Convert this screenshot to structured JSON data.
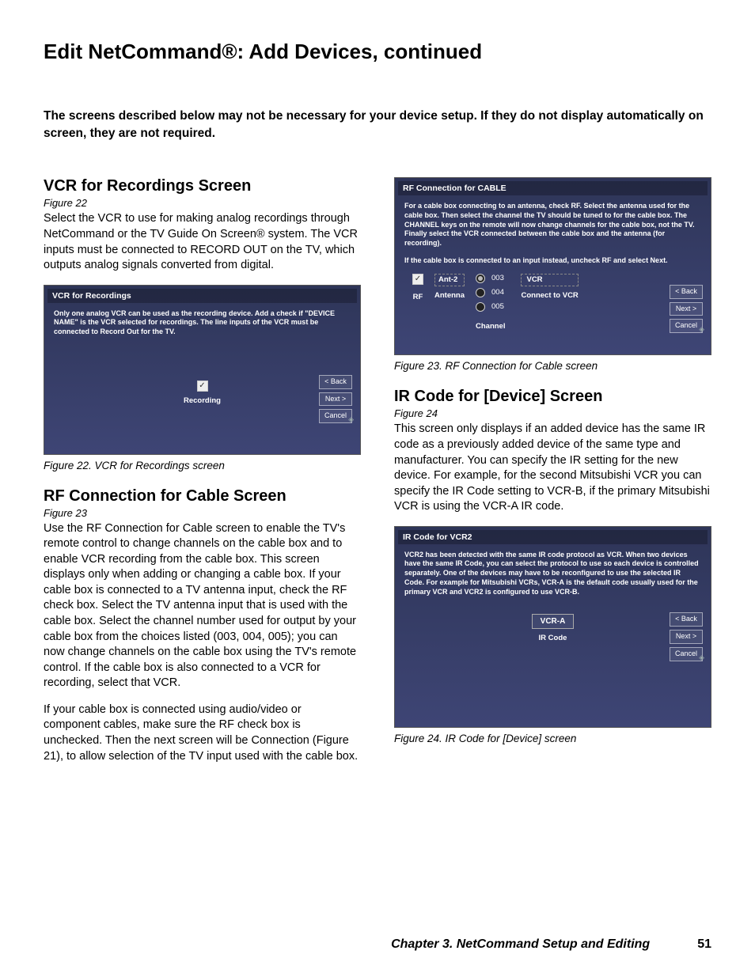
{
  "page_title": "Edit NetCommand®:  Add Devices, continued",
  "intro": "The screens described below may not be necessary for your device setup.  If they do not display automatically on screen, they are not required.",
  "left": {
    "h1": "VCR for Recordings Screen",
    "figref1": "Figure 22",
    "p1": "Select the VCR to use for making analog recordings through NetCommand or the TV Guide On Screen® system.  The VCR inputs must be connected to RECORD OUT on the TV, which outputs analog signals converted from digital.",
    "fig22": {
      "title": "VCR for Recordings",
      "instr": "Only one analog VCR can be used as the recording device.  Add a check if \"DEVICE NAME\" is the VCR selected for recordings.  The line inputs of the VCR must be connected to Record Out for the TV.",
      "label": "Recording",
      "back": "< Back",
      "next": "Next >",
      "cancel": "Cancel"
    },
    "cap1": "Figure 22. VCR for Recordings screen",
    "h2": "RF Connection for Cable Screen",
    "figref2": "Figure 23",
    "p2": "Use the RF Connection for Cable screen to enable the TV's remote control to change channels on the cable box and to enable VCR recording from the cable box.  This screen displays only when adding or changing a cable box.  If your cable box is connected to a TV antenna input, check the RF check box.  Select the TV antenna input that is used with the cable box.  Select the channel number used for output by your cable box from the choices listed (003, 004, 005); you can now change channels on the cable box using the TV's remote control.  If the cable box is also connected to a VCR for recording, select that VCR.",
    "p3": "If your cable box is connected using audio/video or component cables, make sure the RF check box is unchecked.  Then the next screen will be Connection (Figure 21), to allow selection of the TV input used with the cable box."
  },
  "right": {
    "fig23": {
      "title": "RF Connection for CABLE",
      "instr1": "For a cable box connecting to an antenna, check RF. Select the antenna used for the cable box. Then select the channel the TV should be tuned to for the cable box.  The CHANNEL keys on the remote will now change channels for the cable box, not the TV.  Finally select the VCR connected between the cable box and the antenna (for recording).",
      "instr2": "If the cable box is connected to an input instead, uncheck RF and select Next.",
      "rf_label": "RF",
      "ant2": "Ant-2",
      "antenna": "Antenna",
      "ch003": "003",
      "ch004": "004",
      "ch005": "005",
      "channel": "Channel",
      "vcr": "VCR",
      "connect": "Connect to VCR",
      "back": "< Back",
      "next": "Next >",
      "cancel": "Cancel"
    },
    "cap1": "Figure 23. RF Connection for Cable screen",
    "h1": "IR Code for [Device] Screen",
    "figref1": "Figure 24",
    "p1": "This screen only displays if an added device has the same IR code as a previously added device of the same type and manufacturer.  You can specify the IR setting for the new device.  For example, for the second Mitsubishi VCR you can specify the IR Code setting to VCR-B, if the primary Mitsubishi VCR is using the VCR-A IR code.",
    "fig24": {
      "title": "IR Code for VCR2",
      "instr": "VCR2 has been detected with the same IR code protocol as VCR. When two devices have the same IR Code, you can select the protocol to use so each device is controlled separately. One of the devices may have to be reconfigured to use the selected IR Code.  For example for Mitsubishi VCRs, VCR-A is the default code usually used for the primary VCR and VCR2 is configured to use VCR-B.",
      "code": "VCR-A",
      "label": "IR Code",
      "back": "< Back",
      "next": "Next >",
      "cancel": "Cancel"
    },
    "cap2": "Figure 24. IR Code for [Device] screen"
  },
  "footer": {
    "chapter": "Chapter 3. NetCommand Setup and Editing",
    "page": "51"
  }
}
